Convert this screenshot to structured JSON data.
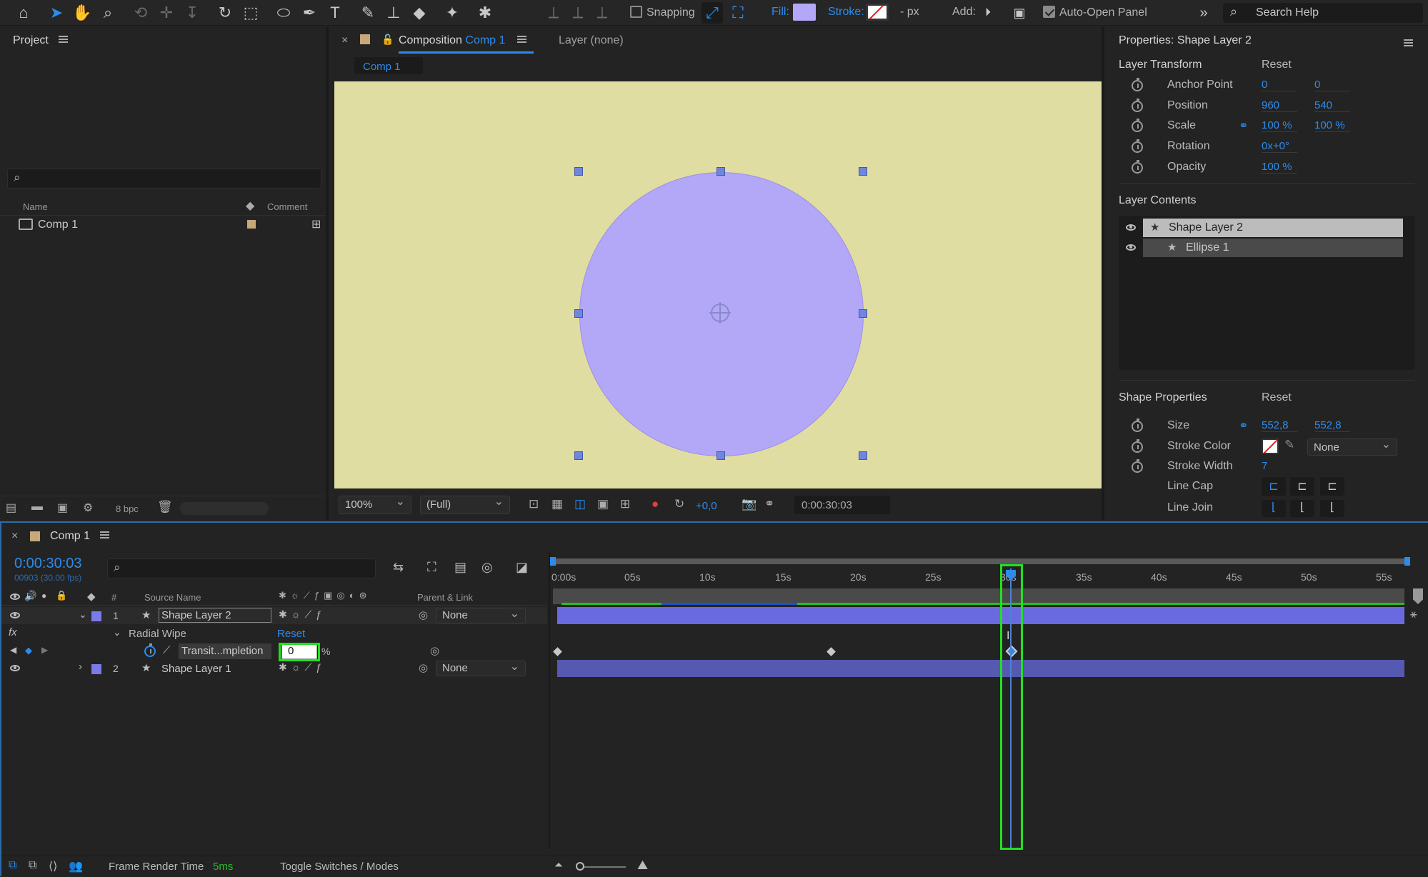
{
  "toolbar": {
    "snapping": "Snapping",
    "fill": "Fill:",
    "fill_color": "#b3a8f8",
    "stroke": "Stroke:",
    "stroke_unit": "- px",
    "add": "Add:",
    "auto_open": "Auto-Open Panel",
    "search_help": "Search Help"
  },
  "project": {
    "title": "Project",
    "col_name": "Name",
    "col_comment": "Comment",
    "item": "Comp 1",
    "bpc": "8 bpc"
  },
  "composition": {
    "tab_prefix": "Composition",
    "tab_comp": "Comp 1",
    "layer_tab": "Layer (none)",
    "subtab": "Comp 1",
    "bg_color": "#e0dda2",
    "circle_color": "#b3a8f8",
    "zoom": "100%",
    "resolution": "(Full)",
    "exposure": "+0,0",
    "timecode": "0:00:30:03"
  },
  "properties": {
    "title": "Properties: Shape Layer 2",
    "layer_transform": "Layer Transform",
    "reset": "Reset",
    "anchor_point": "Anchor Point",
    "anchor_x": "0",
    "anchor_y": "0",
    "position": "Position",
    "pos_x": "960",
    "pos_y": "540",
    "scale": "Scale",
    "scale_x": "100 %",
    "scale_y": "100 %",
    "rotation": "Rotation",
    "rotation_val": "0x+0°",
    "opacity": "Opacity",
    "opacity_val": "100 %",
    "layer_contents": "Layer Contents",
    "content_layer": "Shape Layer 2",
    "content_ellipse": "Ellipse 1",
    "shape_properties": "Shape Properties",
    "size": "Size",
    "size_x": "552,8",
    "size_y": "552,8",
    "stroke_color": "Stroke Color",
    "stroke_none": "None",
    "stroke_width": "Stroke Width",
    "stroke_width_val": "7",
    "line_cap": "Line Cap",
    "line_join": "Line Join"
  },
  "timeline": {
    "tab": "Comp 1",
    "timecode": "0:00:30:03",
    "frames": "00903 (30.00 fps)",
    "col_source": "Source Name",
    "col_parent": "Parent & Link",
    "layer1_num": "1",
    "layer1_name": "Shape Layer 2",
    "layer1_parent": "None",
    "effect": "Radial Wipe",
    "effect_reset": "Reset",
    "transition": "Transit...mpletion",
    "transition_val": "0",
    "transition_unit": "%",
    "layer2_num": "2",
    "layer2_name": "Shape Layer 1",
    "layer2_parent": "None",
    "ticks": [
      "0:00s",
      "05s",
      "10s",
      "15s",
      "20s",
      "25s",
      "30s",
      "35s",
      "40s",
      "45s",
      "50s",
      "55s"
    ],
    "frame_render": "Frame Render Time",
    "frame_render_val": "5ms",
    "toggle": "Toggle Switches / Modes"
  }
}
